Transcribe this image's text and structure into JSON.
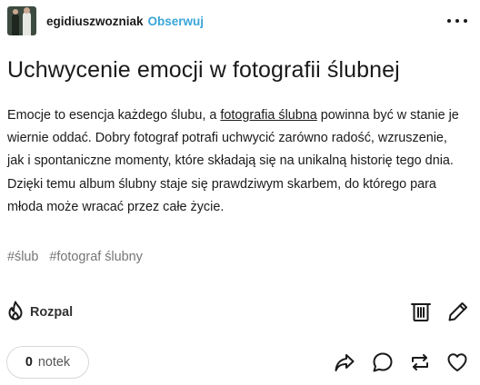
{
  "header": {
    "username": "egidiuszwozniak",
    "follow_label": "Obserwuj"
  },
  "post": {
    "title": "Uchwycenie emocji w fotografii ślubnej",
    "body_part1": "Emocje to esencja każdego ślubu, a ",
    "body_link": "fotografia ślubna",
    "body_part2": " powinna być w stanie je wiernie oddać. Dobry fotograf potrafi uchwycić zarówno radość, wzruszenie, jak i spontaniczne momenty, które składają się na unikalną historię tego dnia. Dzięki temu album ślubny staje się prawdziwym skarbem, do którego para młoda może wracać przez całe życie.",
    "tags": [
      "#ślub",
      "#fotograf ślubny"
    ]
  },
  "actions": {
    "rozpal_label": "Rozpal",
    "notes_count": "0",
    "notes_label": "notek"
  },
  "icons": {
    "more": "more-dots-icon",
    "rozpal": "flame-icon",
    "delete": "trash-icon",
    "edit": "pencil-icon",
    "share": "share-arrow-icon",
    "reply": "comment-bubble-icon",
    "reblog": "reblog-icon",
    "like": "heart-icon"
  },
  "colors": {
    "accent": "#3aa5d9",
    "text": "#1a1a1a",
    "muted": "#767676"
  }
}
